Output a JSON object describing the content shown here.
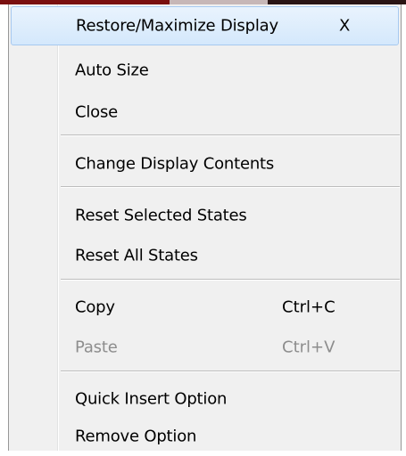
{
  "menu": {
    "items": [
      {
        "label": "Restore/Maximize Display",
        "shortcut": "X"
      },
      {
        "label": "Auto Size",
        "shortcut": ""
      },
      {
        "label": "Close",
        "shortcut": ""
      },
      {
        "label": "Change Display Contents",
        "shortcut": ""
      },
      {
        "label": "Reset Selected States",
        "shortcut": ""
      },
      {
        "label": "Reset All States",
        "shortcut": ""
      },
      {
        "label": "Copy",
        "shortcut": "Ctrl+C"
      },
      {
        "label": "Paste",
        "shortcut": "Ctrl+V"
      },
      {
        "label": "Quick Insert Option",
        "shortcut": ""
      },
      {
        "label": "Remove Option",
        "shortcut": ""
      }
    ]
  }
}
